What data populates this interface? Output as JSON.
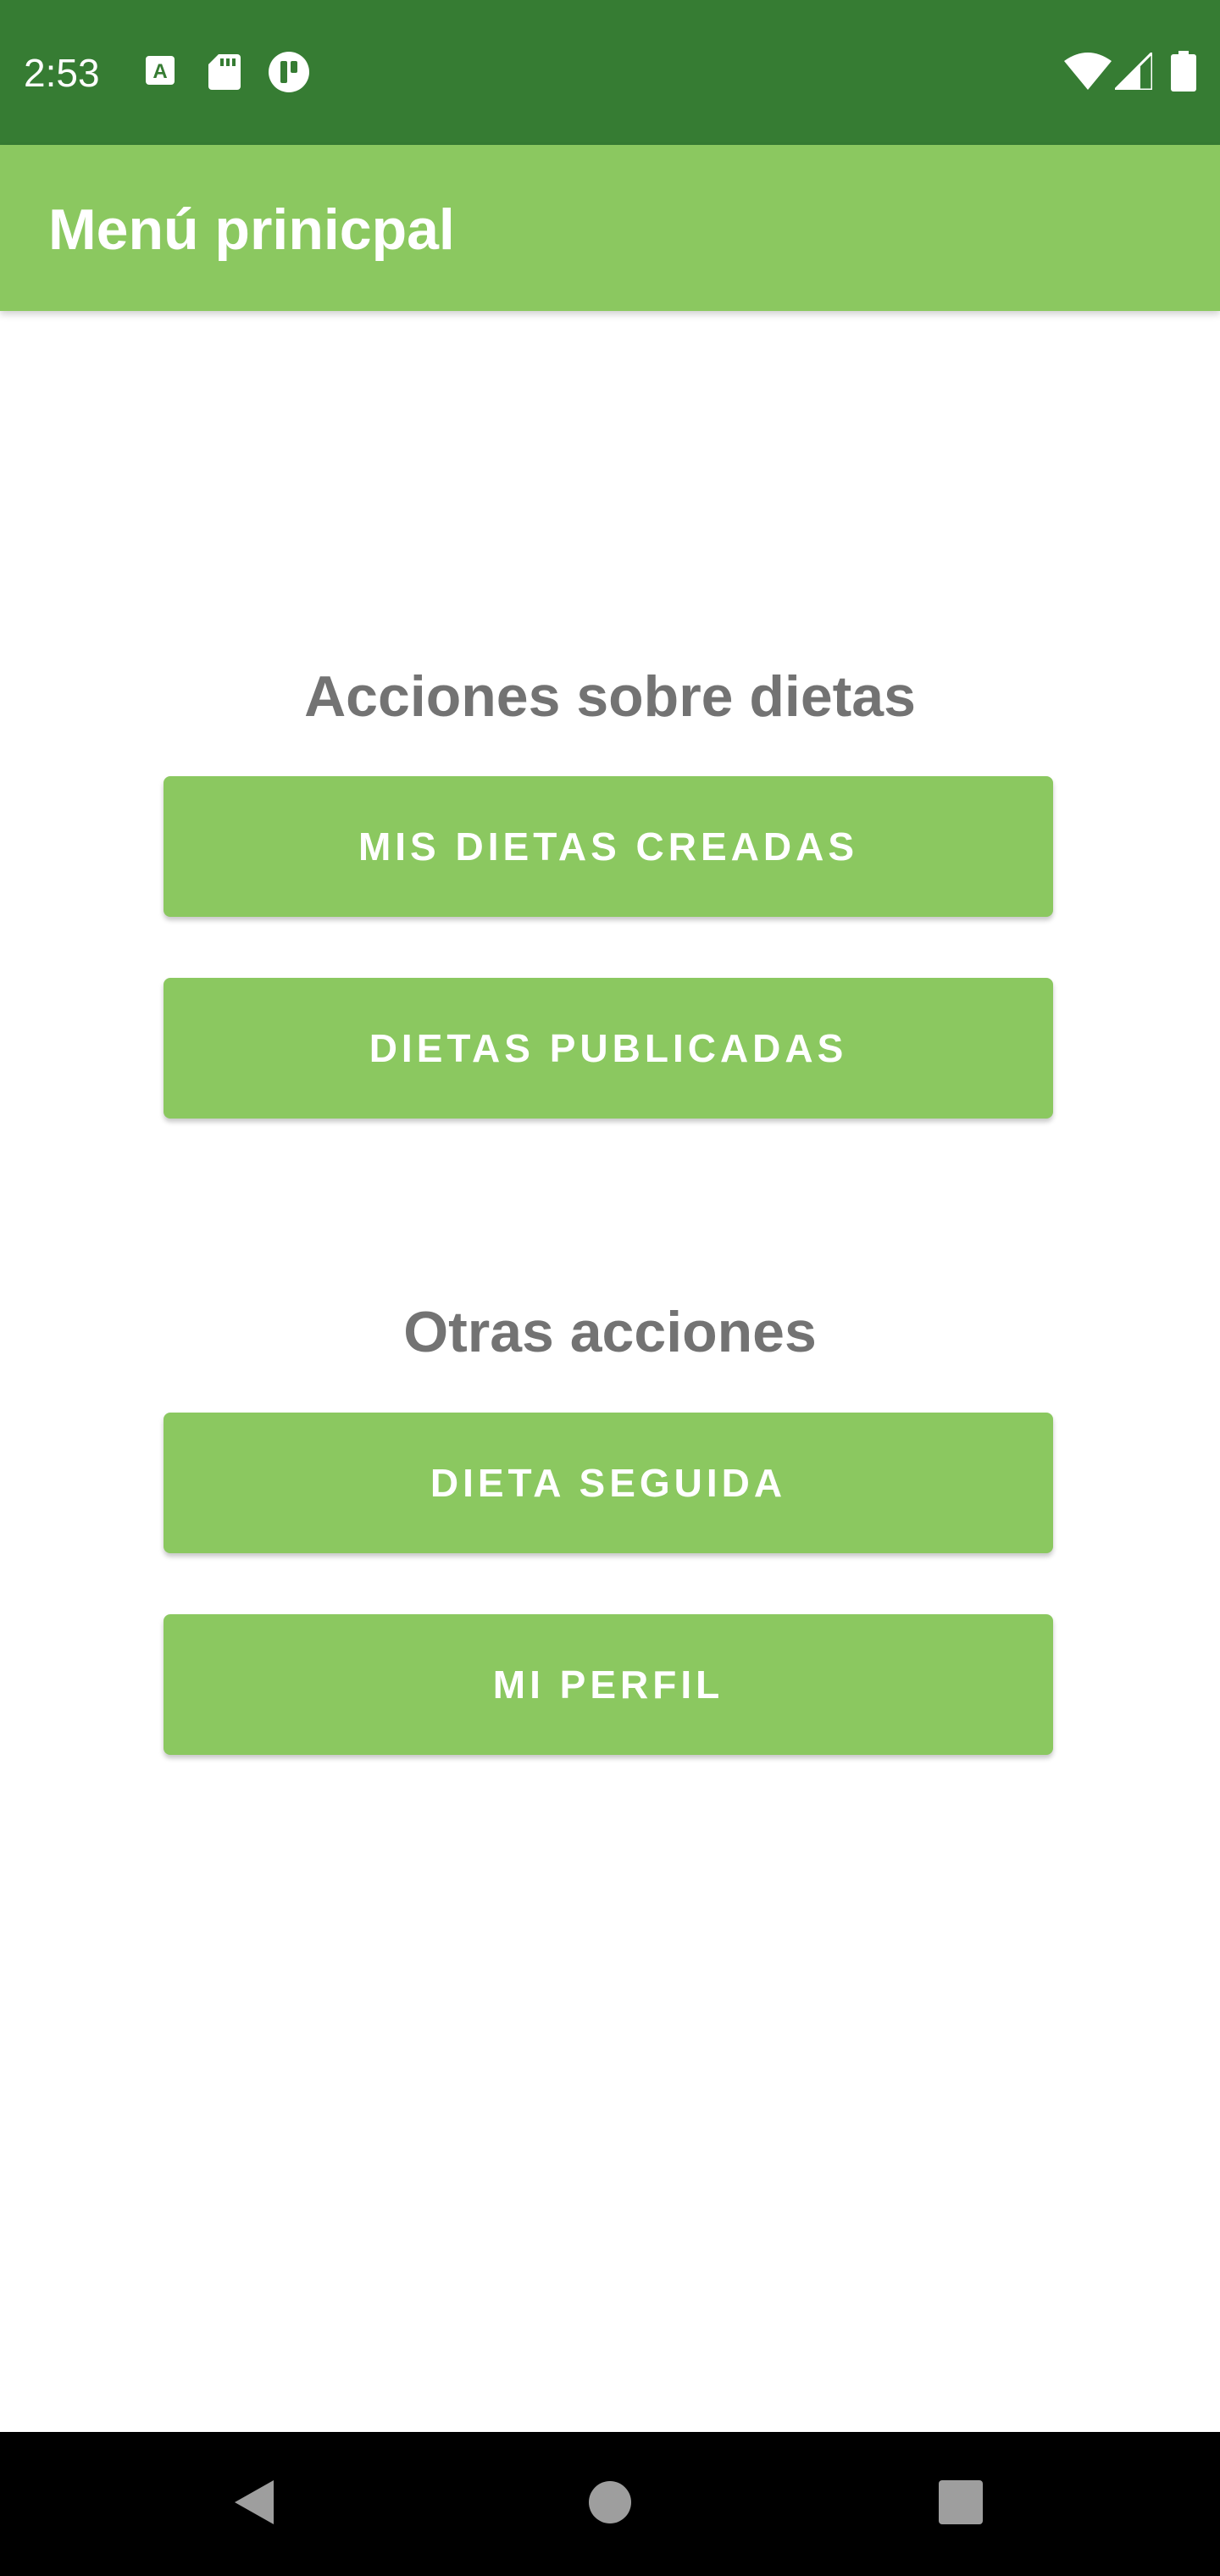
{
  "status_bar": {
    "time": "2:53",
    "left_icons": [
      "font-notification-icon",
      "sd-card-icon",
      "app-notification-icon"
    ],
    "right_icons": [
      "wifi-icon",
      "cellular-signal-icon",
      "battery-icon"
    ],
    "background_color": "#367c33"
  },
  "app_bar": {
    "title": "Menú prinicpal",
    "background_color": "#8bc860"
  },
  "sections": {
    "diets": {
      "heading": "Acciones sobre dietas",
      "buttons": {
        "my_created_diets": "MIS DIETAS CREADAS",
        "published_diets": "DIETAS PUBLICADAS"
      }
    },
    "other": {
      "heading": "Otras acciones",
      "buttons": {
        "followed_diet": "DIETA SEGUIDA",
        "my_profile": "MI PERFIL"
      }
    }
  },
  "nav_bar": {
    "items": [
      "back-icon",
      "home-icon",
      "recents-icon"
    ],
    "background_color": "#000000"
  },
  "colors": {
    "accent": "#8bc860",
    "heading_text": "#737373"
  }
}
